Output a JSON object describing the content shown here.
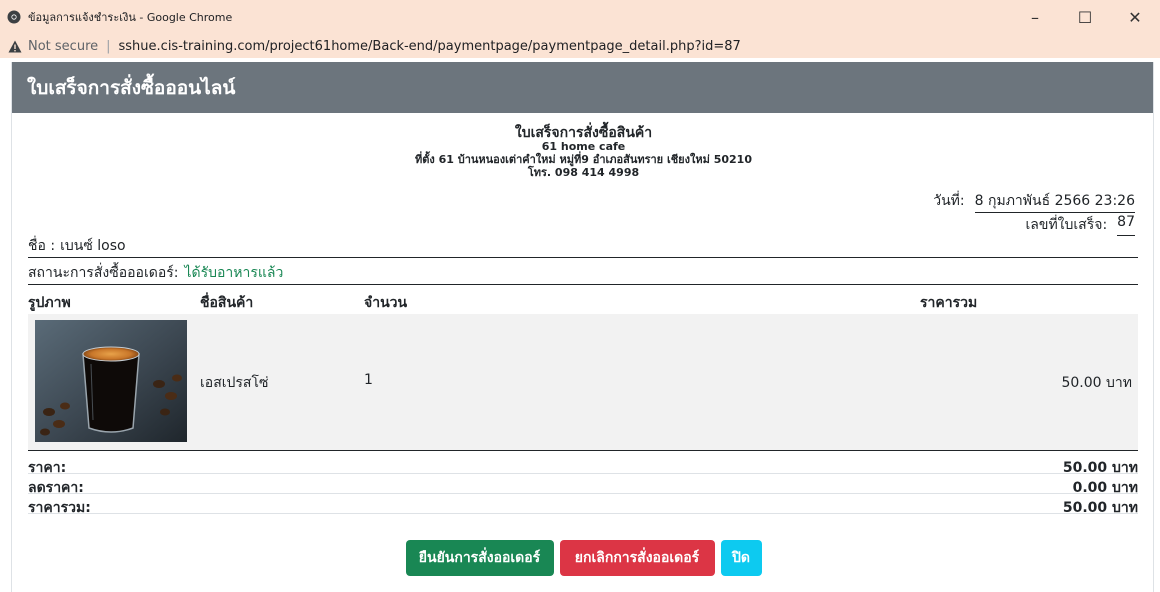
{
  "window": {
    "title": "ข้อมูลการแจ้งชำระเงิน - Google Chrome",
    "minimize": "–",
    "maximize": "☐",
    "close": "✕"
  },
  "address": {
    "security_label": "Not secure",
    "url": "sshue.cis-training.com/project61home/Back-end/paymentpage/paymentpage_detail.php?id=87"
  },
  "modal": {
    "title": "ใบเสร็จการสั่งซื้อออนไลน์"
  },
  "receipt": {
    "heading": "ใบเสร็จการสั่งซื้อสินค้า",
    "shop": "61 home cafe",
    "address": "ที่ตั้ง 61 บ้านหนองเต่าคำใหม่ หมู่ที่9 อำเภอสันทราย เชียงใหม่ 50210",
    "phone": "โทร. 098 414 4998",
    "date_label": "วันที่:",
    "date_value": "8 กุมภาพันธ์ 2566 23:26",
    "bill_label": "เลขที่ใบเสร็จ:",
    "bill_value": "87",
    "name_label": "ชื่อ :",
    "name_value": "เบนซ์ loso",
    "status_label": "สถานะการสั่งซื้อออเดอร์:",
    "status_value": "ได้รับอาหารแล้ว",
    "status_color": "#198754"
  },
  "table": {
    "headers": {
      "image": "รูปภาพ",
      "name": "ชื่อสินค้า",
      "qty": "จำนวน",
      "total": "ราคารวม"
    },
    "rows": [
      {
        "image": "espresso-photo",
        "name": "เอสเปรสโซ่",
        "qty": "1",
        "total": "50.00 บาท"
      }
    ]
  },
  "summary": {
    "price_label": "ราคา:",
    "price_value": "50.00 บาท",
    "discount_label": "ลดราคา:",
    "discount_value": "0.00 บาท",
    "total_label": "ราคารวม:",
    "total_value": "50.00 บาท"
  },
  "buttons": {
    "confirm": "ยืนยันการสั่งออเดอร์",
    "cancel": "ยกเลิกการสั่งออเดอร์",
    "close": "ปิด"
  },
  "colors": {
    "header_bg": "#6c757d",
    "success": "#198754",
    "danger": "#dc3545",
    "info": "#0dcaf0",
    "chrome_bar": "#fbe3d4"
  }
}
